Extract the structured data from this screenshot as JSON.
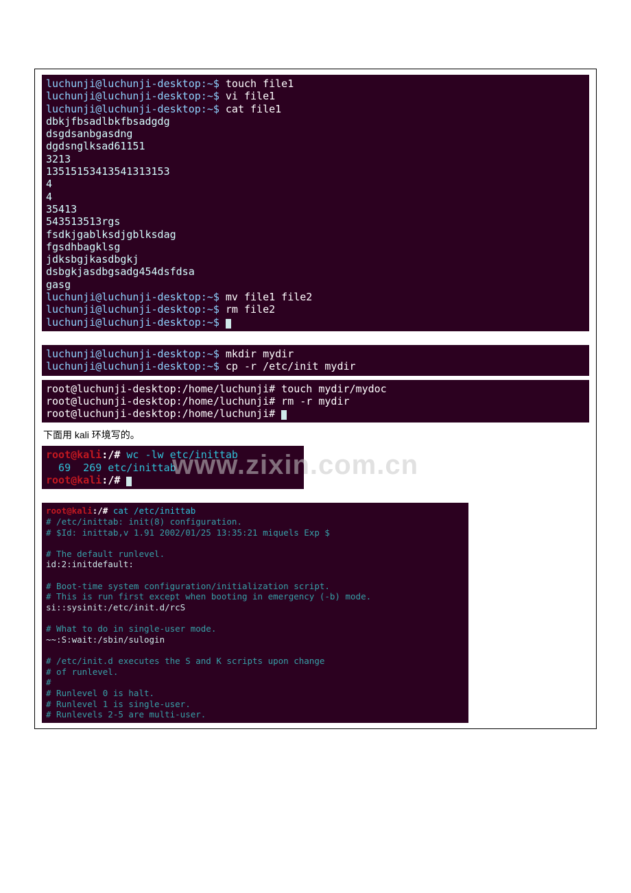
{
  "block1": {
    "prompt": "luchunji@luchunji-desktop:~$",
    "lines": [
      {
        "type": "cmd",
        "cmd": "touch file1"
      },
      {
        "type": "cmd",
        "cmd": "vi file1"
      },
      {
        "type": "cmd",
        "cmd": "cat file1"
      },
      {
        "type": "out",
        "text": "dbkjfbsadlbkfbsadgdg"
      },
      {
        "type": "out",
        "text": "dsgdsanbgasdng"
      },
      {
        "type": "out",
        "text": "dgdsnglksad61151"
      },
      {
        "type": "out",
        "text": "3213"
      },
      {
        "type": "out",
        "text": "13515153413541313153"
      },
      {
        "type": "out",
        "text": "4"
      },
      {
        "type": "out",
        "text": "4"
      },
      {
        "type": "out",
        "text": "35413"
      },
      {
        "type": "out",
        "text": "543513513rgs"
      },
      {
        "type": "out",
        "text": "fsdkjgablksdjgblksdag"
      },
      {
        "type": "out",
        "text": "fgsdhbagklsg"
      },
      {
        "type": "out",
        "text": "jdksbgjkasdbgkj"
      },
      {
        "type": "out",
        "text": "dsbgkjasdbgsadg454dsfdsa"
      },
      {
        "type": "out",
        "text": "gasg"
      },
      {
        "type": "cmd",
        "cmd": "mv file1 file2"
      },
      {
        "type": "cmd",
        "cmd": "rm file2"
      },
      {
        "type": "cmd",
        "cmd": "",
        "cursor": true
      }
    ]
  },
  "block2": {
    "prompt": "luchunji@luchunji-desktop:~$",
    "lines": [
      {
        "type": "cmd",
        "cmd": "mkdir mydir"
      },
      {
        "type": "cmd",
        "cmd": "cp -r /etc/init mydir"
      }
    ]
  },
  "block3": {
    "prompt": "root@luchunji-desktop:/home/luchunji#",
    "lines": [
      {
        "type": "cmd",
        "cmd": "touch mydir/mydoc"
      },
      {
        "type": "cmd",
        "cmd": "rm -r mydir"
      },
      {
        "type": "cmd",
        "cmd": "",
        "cursor": true
      }
    ]
  },
  "caption1": "下面用 kali 环境写的。",
  "block4": {
    "prompt_user": "root@kali",
    "prompt_sep": ":",
    "prompt_path": "/#",
    "lines": [
      {
        "type": "cmd",
        "cmd": "wc -lw etc/inittab"
      },
      {
        "type": "out",
        "text": "  69  269 etc/inittab"
      },
      {
        "type": "cmd",
        "cmd": "",
        "cursor": true
      }
    ]
  },
  "block5": {
    "prompt_user": "root@kali",
    "prompt_sep": ":",
    "prompt_path": "/#",
    "cmd": "cat /etc/inittab",
    "body": [
      {
        "c": "comment",
        "t": "# /etc/inittab: init(8) configuration."
      },
      {
        "c": "comment",
        "t": "# $Id: inittab,v 1.91 2002/01/25 13:35:21 miquels Exp $"
      },
      {
        "c": "blank",
        "t": ""
      },
      {
        "c": "comment",
        "t": "# The default runlevel."
      },
      {
        "c": "cfgline",
        "t": "id:2:initdefault:"
      },
      {
        "c": "blank",
        "t": ""
      },
      {
        "c": "comment",
        "t": "# Boot-time system configuration/initialization script."
      },
      {
        "c": "comment",
        "t": "# This is run first except when booting in emergency (-b) mode."
      },
      {
        "c": "cfgline",
        "t": "si::sysinit:/etc/init.d/rcS"
      },
      {
        "c": "blank",
        "t": ""
      },
      {
        "c": "comment",
        "t": "# What to do in single-user mode."
      },
      {
        "c": "cfgline",
        "t": "~~:S:wait:/sbin/sulogin"
      },
      {
        "c": "blank",
        "t": ""
      },
      {
        "c": "comment",
        "t": "# /etc/init.d executes the S and K scripts upon change"
      },
      {
        "c": "comment",
        "t": "# of runlevel."
      },
      {
        "c": "comment",
        "t": "#"
      },
      {
        "c": "comment",
        "t": "# Runlevel 0 is halt."
      },
      {
        "c": "comment",
        "t": "# Runlevel 1 is single-user."
      },
      {
        "c": "comment",
        "t": "# Runlevels 2-5 are multi-user."
      }
    ]
  },
  "watermark": "www.zixin.com.cn"
}
